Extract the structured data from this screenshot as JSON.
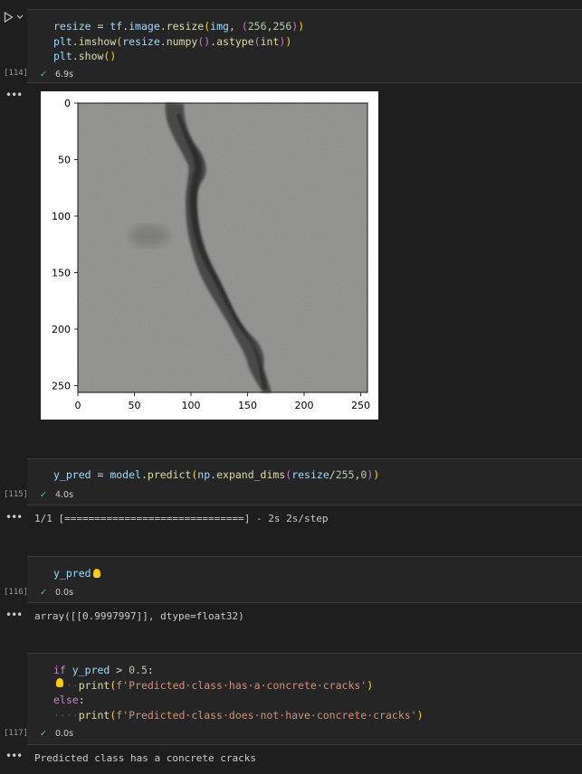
{
  "cells": [
    {
      "exec_count": "[114]",
      "code_lines": [
        [
          [
            "var",
            "resize"
          ],
          [
            "op",
            " = "
          ],
          [
            "var",
            "tf"
          ],
          [
            "op",
            "."
          ],
          [
            "var",
            "image"
          ],
          [
            "op",
            "."
          ],
          [
            "fn",
            "resize"
          ],
          [
            "p1",
            "("
          ],
          [
            "var",
            "img"
          ],
          [
            "op",
            ", "
          ],
          [
            "p2",
            "("
          ],
          [
            "num",
            "256"
          ],
          [
            "op",
            ","
          ],
          [
            "num",
            "256"
          ],
          [
            "p2",
            ")"
          ],
          [
            "p1",
            ")"
          ]
        ],
        [
          [
            "var",
            "plt"
          ],
          [
            "op",
            "."
          ],
          [
            "fn",
            "imshow"
          ],
          [
            "p1",
            "("
          ],
          [
            "var",
            "resize"
          ],
          [
            "op",
            "."
          ],
          [
            "fn",
            "numpy"
          ],
          [
            "p2",
            "()"
          ],
          [
            "op",
            "."
          ],
          [
            "fn",
            "astype"
          ],
          [
            "p2",
            "("
          ],
          [
            "fn",
            "int"
          ],
          [
            "p2",
            ")"
          ],
          [
            "p1",
            ")"
          ]
        ],
        [
          [
            "var",
            "plt"
          ],
          [
            "op",
            "."
          ],
          [
            "fn",
            "show"
          ],
          [
            "p1",
            "()"
          ]
        ]
      ],
      "status": "6.9s"
    },
    {
      "exec_count": "[115]",
      "code_lines": [
        [
          [
            "var",
            "y_pred"
          ],
          [
            "op",
            " = "
          ],
          [
            "var",
            "model"
          ],
          [
            "op",
            "."
          ],
          [
            "fn",
            "predict"
          ],
          [
            "p1",
            "("
          ],
          [
            "var",
            "np"
          ],
          [
            "op",
            "."
          ],
          [
            "fn",
            "expand_dims"
          ],
          [
            "p2",
            "("
          ],
          [
            "var",
            "resize"
          ],
          [
            "op",
            "/"
          ],
          [
            "num",
            "255"
          ],
          [
            "op",
            ","
          ],
          [
            "num",
            "0"
          ],
          [
            "p2",
            ")"
          ],
          [
            "p1",
            ")"
          ]
        ]
      ],
      "status": "4.0s",
      "output": "1/1 [==============================] - 2s 2s/step"
    },
    {
      "exec_count": "[116]",
      "code_lines": [
        [
          [
            "var",
            "y_pred"
          ]
        ]
      ],
      "status": "0.0s",
      "output": "array([[0.9997997]], dtype=float32)"
    },
    {
      "exec_count": "[117]",
      "code_lines": [
        [
          [
            "kw",
            "if"
          ],
          [
            "op",
            " "
          ],
          [
            "var",
            "y_pred"
          ],
          [
            "op",
            " > "
          ],
          [
            "num",
            "0.5"
          ],
          [
            "op",
            ":"
          ]
        ],
        [
          [
            "ws",
            "····"
          ],
          [
            "fn",
            "print"
          ],
          [
            "p1",
            "("
          ],
          [
            "str",
            "f'Predicted·class·has·a·concrete·cracks'"
          ],
          [
            "p1",
            ")"
          ]
        ],
        [
          [
            "kw",
            "else"
          ],
          [
            "op",
            ":"
          ]
        ],
        [
          [
            "ws",
            "····"
          ],
          [
            "fn",
            "print"
          ],
          [
            "p1",
            "("
          ],
          [
            "str",
            "f'Predicted·class·does·not·have·concrete·cracks'"
          ],
          [
            "p1",
            ")"
          ]
        ]
      ],
      "status": "0.0s",
      "output": "Predicted class has a concrete cracks"
    }
  ],
  "plot": {
    "xticks": [
      "0",
      "50",
      "100",
      "150",
      "200",
      "250"
    ],
    "yticks": [
      "0",
      "50",
      "100",
      "150",
      "200",
      "250"
    ]
  },
  "icons": {
    "run": "run-cell-icon",
    "expand": "chevron-down-icon",
    "success": "check-icon",
    "output_menu": "ellipsis-icon",
    "hint": "lightbulb-icon"
  },
  "colors": {
    "background": "#1e1e1e",
    "cell": "#252526",
    "check": "#4ec9b0"
  }
}
